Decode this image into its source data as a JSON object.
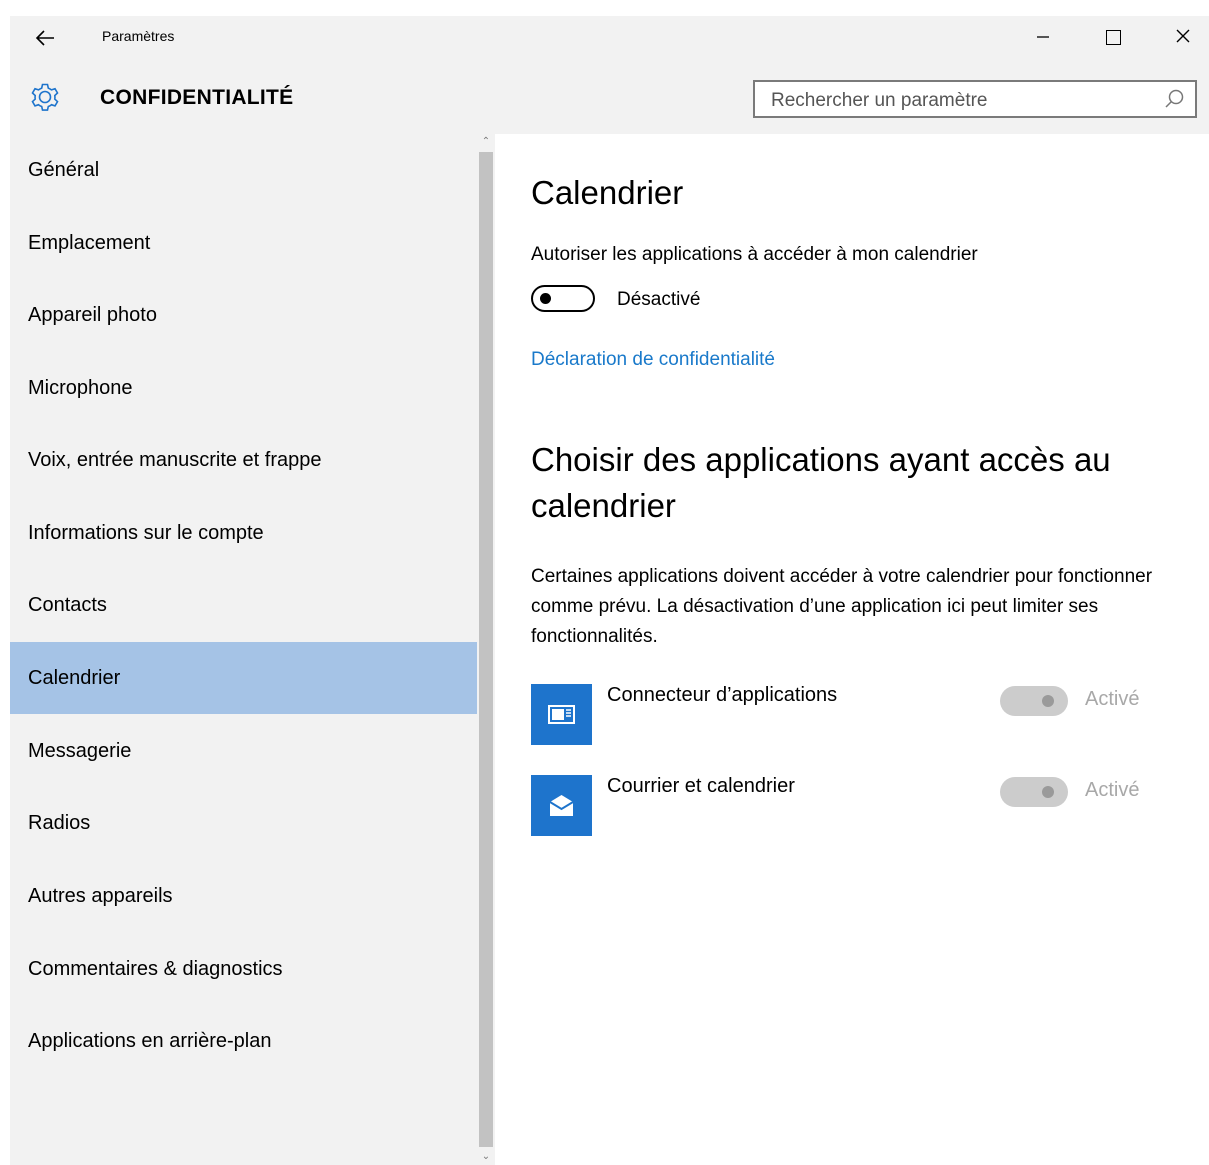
{
  "titlebar": {
    "back_icon": "arrow-left-icon",
    "app_title": "Paramètres",
    "minimize_icon": "minimize-icon",
    "maximize_icon": "maximize-icon",
    "close_icon": "close-icon"
  },
  "header": {
    "icon": "gear-icon",
    "title": "CONFIDENTIALITÉ",
    "search": {
      "placeholder": "Rechercher un paramètre",
      "value": "",
      "icon": "search-icon"
    }
  },
  "sidebar": {
    "items": [
      {
        "label": "Général"
      },
      {
        "label": "Emplacement"
      },
      {
        "label": "Appareil photo"
      },
      {
        "label": "Microphone"
      },
      {
        "label": "Voix, entrée manuscrite et frappe"
      },
      {
        "label": "Informations sur le compte"
      },
      {
        "label": "Contacts"
      },
      {
        "label": "Calendrier",
        "selected": true
      },
      {
        "label": "Messagerie"
      },
      {
        "label": "Radios"
      },
      {
        "label": "Autres appareils"
      },
      {
        "label": "Commentaires & diagnostics"
      },
      {
        "label": "Applications en arrière-plan"
      }
    ],
    "selected_color": "#a5c3e6"
  },
  "main": {
    "title": "Calendrier",
    "setting_label": "Autoriser les applications à accéder à mon calendrier",
    "toggle_state": "Désactivé",
    "privacy_link": "Déclaration de confidentialité",
    "subheading": "Choisir des applications ayant accès au calendrier",
    "description": "Certaines applications doivent accéder à votre calendrier pour fonctionner comme prévu. La désactivation d’une application ici peut limiter ses fonctionnalités.",
    "apps": [
      {
        "name": "Connecteur d’applications",
        "state": "Activé",
        "icon": "app-connector-icon"
      },
      {
        "name": "Courrier et calendrier",
        "state": "Activé",
        "icon": "mail-envelope-icon"
      }
    ],
    "accent_color": "#1e74cc",
    "link_color": "#1979ca"
  }
}
